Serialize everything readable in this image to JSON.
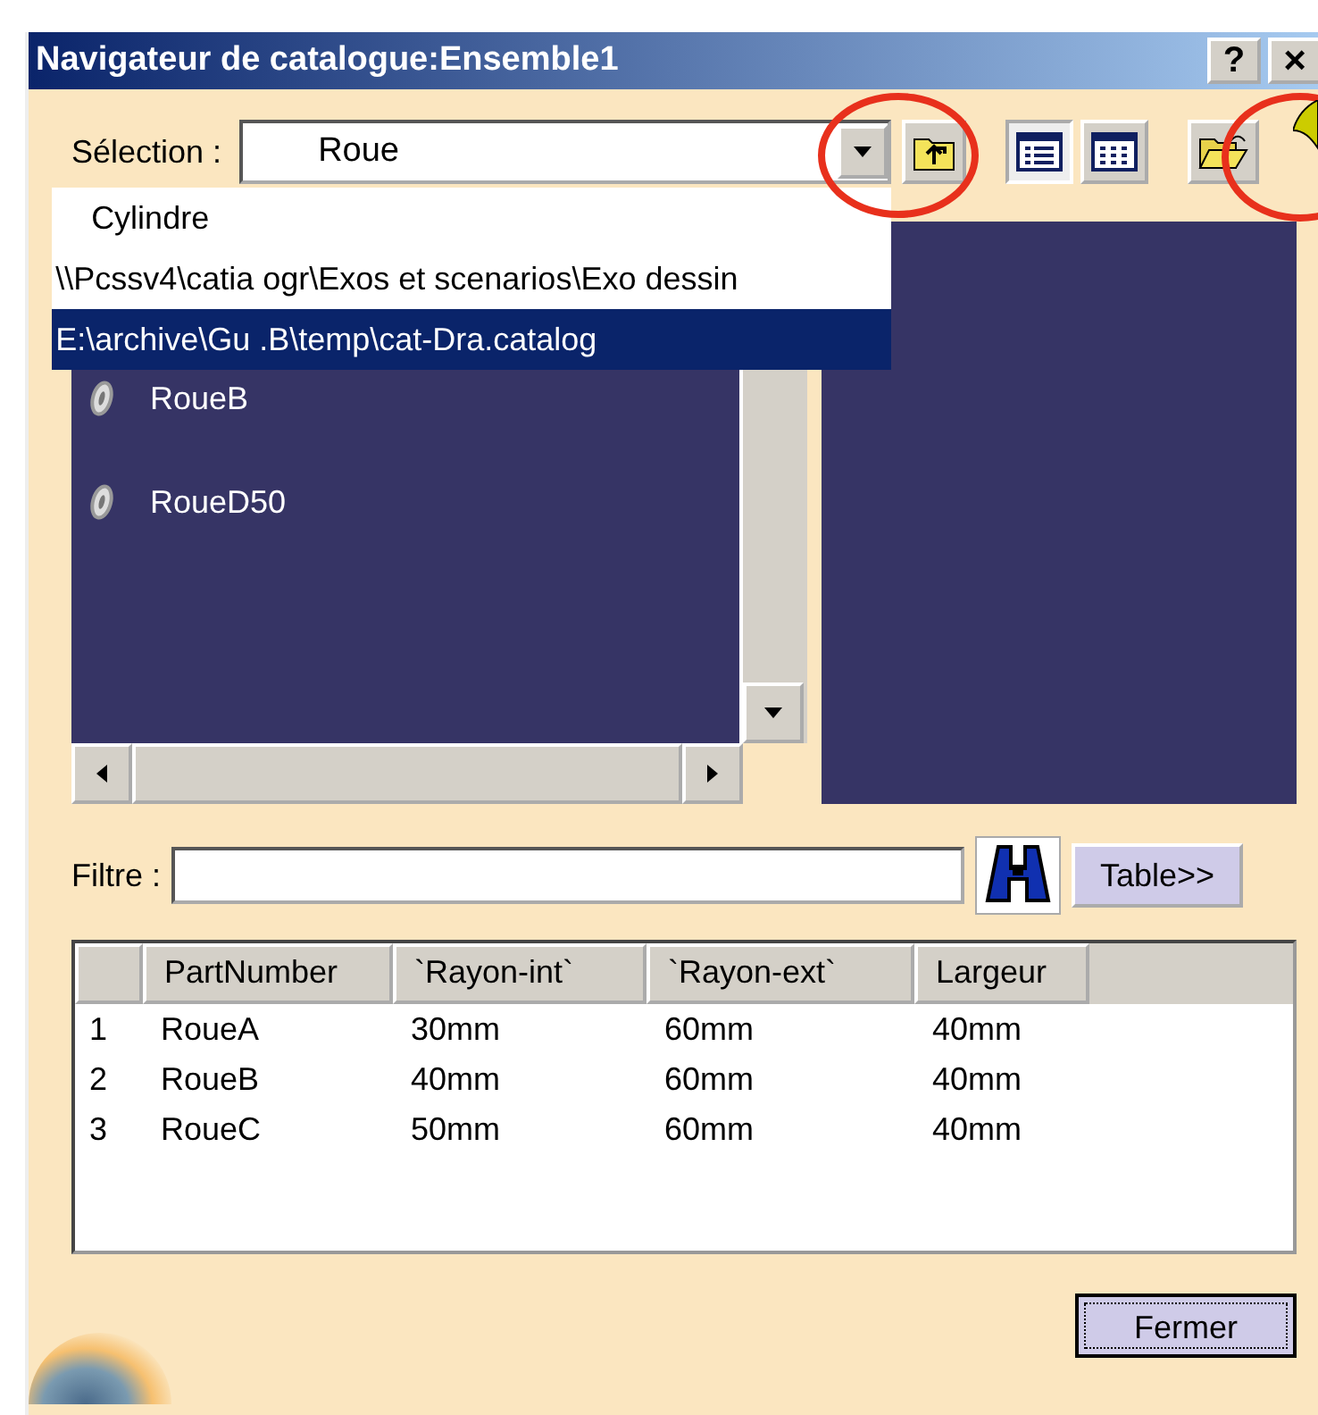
{
  "window": {
    "title": "Navigateur de catalogue:Ensemble1",
    "buttons": [
      {
        "kind": "help",
        "label": "?"
      },
      {
        "kind": "close",
        "label": "×"
      }
    ]
  },
  "selection": {
    "label": "Sélection :",
    "value": "Roue",
    "options": [
      {
        "label": "Cylindre",
        "selected": false
      },
      {
        "label": "\\\\Pcssv4\\catia ogr\\Exos et scenarios\\Exo dessin",
        "selected": false
      },
      {
        "label": "E:\\archive\\Gu .B\\temp\\cat-Dra.catalog",
        "selected": true
      }
    ]
  },
  "view_buttons": [
    {
      "kind": "list",
      "selected": true
    },
    {
      "kind": "grid",
      "selected": false
    }
  ],
  "tree": {
    "items": [
      {
        "label": "RoueB"
      },
      {
        "label": "RoueD50"
      }
    ]
  },
  "filter": {
    "label": "Filtre :",
    "button": "Table>>"
  },
  "table": {
    "columns": [
      "PartNumber",
      "`Rayon-int`",
      "`Rayon-ext`",
      "Largeur"
    ],
    "rows": [
      {
        "number": "1",
        "cells": [
          "RoueA",
          "30mm",
          "60mm",
          "40mm"
        ]
      },
      {
        "number": "2",
        "cells": [
          "RoueB",
          "40mm",
          "60mm",
          "40mm"
        ]
      },
      {
        "number": "3",
        "cells": [
          "RoueC",
          "50mm",
          "60mm",
          "40mm"
        ]
      }
    ]
  },
  "close_button": "Fermer"
}
